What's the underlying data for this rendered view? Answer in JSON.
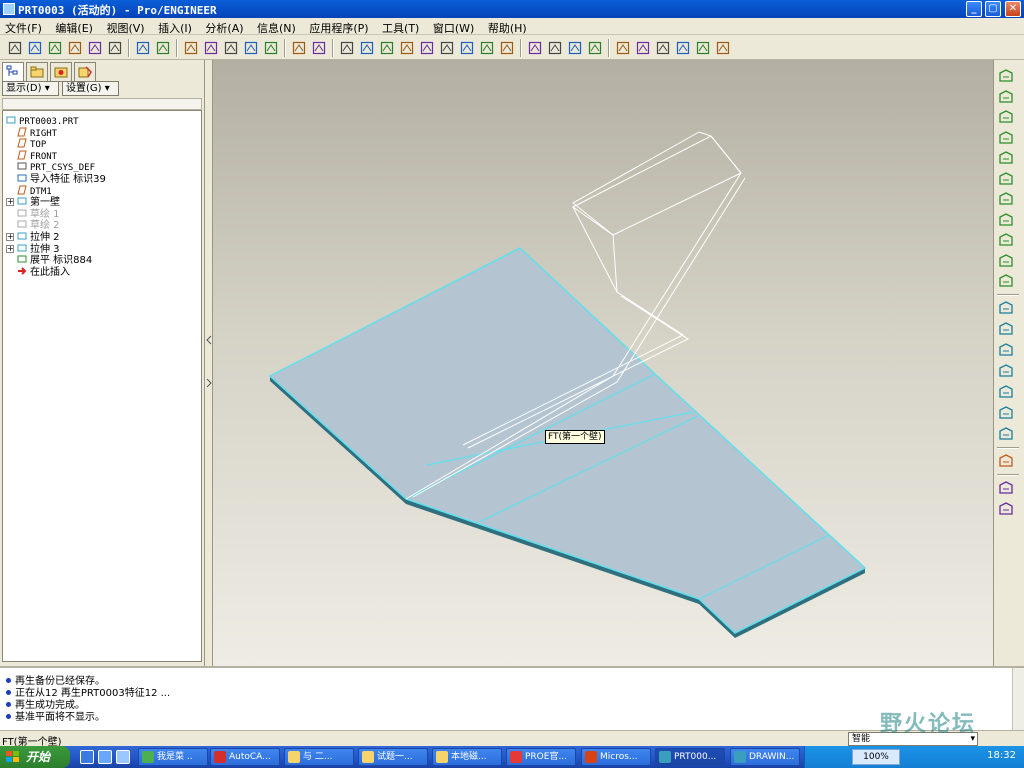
{
  "window": {
    "title": "PRT0003 (活动的) - Pro/ENGINEER",
    "controls": [
      "minimize",
      "maximize",
      "close"
    ]
  },
  "menu": [
    "文件(F)",
    "编辑(E)",
    "视图(V)",
    "插入(I)",
    "分析(A)",
    "信息(N)",
    "应用程序(P)",
    "工具(T)",
    "窗口(W)",
    "帮助(H)"
  ],
  "toolbar": {
    "icons": [
      "new-icon",
      "open-icon",
      "save-icon",
      "print-icon",
      "email-icon",
      "email-link-icon",
      "undo-icon",
      "redo-icon",
      "cut-icon",
      "copy-icon",
      "paste-icon",
      "paste-special-icon",
      "regenerate-icon",
      "selection-box-icon",
      "repaint-icon",
      "spin-center-icon",
      "orient-mode-icon",
      "zoom-in-icon",
      "zoom-out-icon",
      "refit-icon",
      "reorient-icon",
      "saved-views-icon",
      "layers-icon",
      "view-manager-icon",
      "wireframe-icon",
      "hidden-line-icon",
      "no-hidden-icon",
      "shading-icon",
      "datum-planes-icon",
      "datum-axes-icon",
      "datum-points-icon",
      "coord-sys-icon",
      "annotations-icon",
      "context-help-icon"
    ]
  },
  "panel": {
    "tabs": [
      "model-tree-tab",
      "folder-browser-tab",
      "favorites-tab",
      "connections-tab"
    ],
    "show_button": "显示(D)",
    "settings_button": "设置(G)"
  },
  "tree": {
    "items": [
      {
        "label": "PRT0003.PRT",
        "icon": "part-icon",
        "indent": 0,
        "gray": false,
        "expandable": false
      },
      {
        "label": "RIGHT",
        "icon": "datum-plane-icon",
        "indent": 1,
        "gray": false,
        "expandable": false
      },
      {
        "label": "TOP",
        "icon": "datum-plane-icon",
        "indent": 1,
        "gray": false,
        "expandable": false
      },
      {
        "label": "FRONT",
        "icon": "datum-plane-icon",
        "indent": 1,
        "gray": false,
        "expandable": false
      },
      {
        "label": "PRT_CSYS_DEF",
        "icon": "coord-sys-icon",
        "indent": 1,
        "gray": false,
        "expandable": false
      },
      {
        "label": "导入特征 标识39",
        "icon": "import-feature-icon",
        "indent": 1,
        "gray": false,
        "expandable": false
      },
      {
        "label": "DTM1",
        "icon": "datum-plane-icon",
        "indent": 1,
        "gray": false,
        "expandable": false
      },
      {
        "label": "第一壁",
        "icon": "sheetmetal-wall-icon",
        "indent": 1,
        "gray": false,
        "expandable": true
      },
      {
        "label": "草绘 1",
        "icon": "sketch-icon",
        "indent": 1,
        "gray": true,
        "expandable": false
      },
      {
        "label": "草绘 2",
        "icon": "sketch-icon",
        "indent": 1,
        "gray": true,
        "expandable": false
      },
      {
        "label": "拉伸 2",
        "icon": "extrude-icon",
        "indent": 1,
        "gray": false,
        "expandable": true
      },
      {
        "label": "拉伸 3",
        "icon": "extrude-icon",
        "indent": 1,
        "gray": false,
        "expandable": true
      },
      {
        "label": "展平 标识884",
        "icon": "unbend-icon",
        "indent": 1,
        "gray": false,
        "expandable": false
      },
      {
        "label": "在此插入",
        "icon": "insert-here-icon",
        "indent": 1,
        "gray": false,
        "expandable": false
      }
    ]
  },
  "graphics": {
    "tooltip": "FT(第一个壁)",
    "colors": {
      "shaded": "#b4c4d0",
      "edge": "#5fe0ee",
      "thickness": "#2f6f7e",
      "wire": "#ffffff"
    }
  },
  "right_toolbar": {
    "icons": [
      "wall-icon",
      "flange-icon",
      "unbend-icon",
      "bend-back-icon",
      "form-icon",
      "punch-icon",
      "rip-icon",
      "bend-icon",
      "edge-bend-icon",
      "flat-pattern-icon",
      "merge-icon",
      "datum-curve-icon",
      "datum-plane-tool-icon",
      "datum-axis-tool-icon",
      "sketch-curve-icon",
      "datum-point-tool-icon",
      "coord-sys-tool-icon",
      "analysis-icon",
      "style-icon",
      "select-icon",
      "select-filter-icon"
    ]
  },
  "messages": [
    "再生备份已经保存。",
    "正在从12 再生PRT0003特征12 ...",
    "再生成功完成。",
    "基准平面将不显示。"
  ],
  "status": {
    "text": "FT(第一个壁)",
    "filter": "智能"
  },
  "taskbar": {
    "start": "开始",
    "tasks": [
      "我是菜 ..",
      "AutoCA...",
      "与 二...",
      "试题一...",
      "本地磁...",
      "PROE官...",
      "Micros...",
      "PRT000...",
      "DRAWIN..."
    ],
    "active_task": 7,
    "lang": "100%",
    "clock": "18:32"
  },
  "watermark": "野火论坛"
}
